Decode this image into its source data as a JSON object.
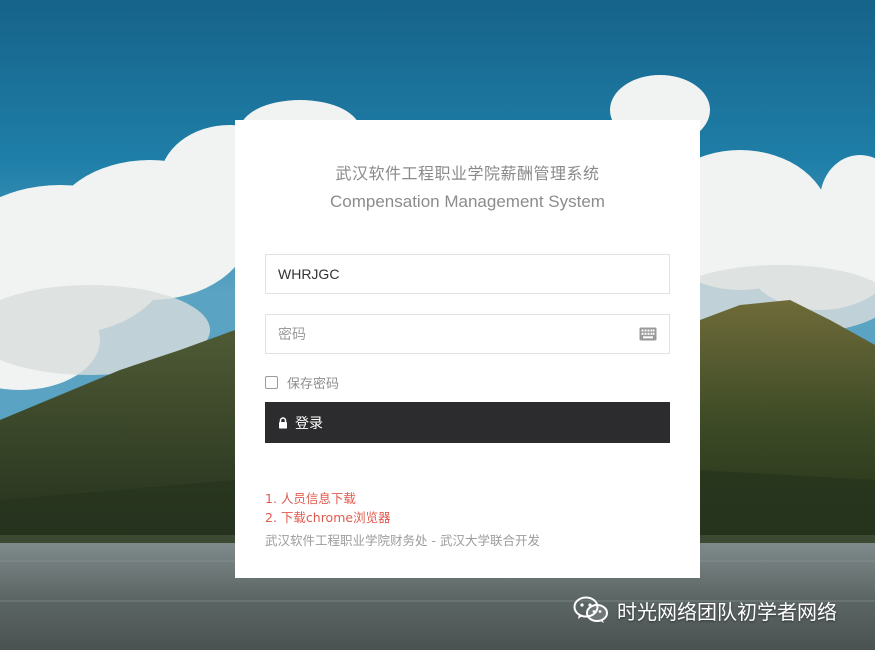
{
  "login": {
    "title_cn": "武汉软件工程职业学院薪酬管理系统",
    "title_en": "Compensation Management System",
    "username_value": "WHRJGC",
    "password_placeholder": "密码",
    "remember_label": "保存密码",
    "remember_checked": false,
    "login_button": "登录",
    "link_1": "1. 人员信息下载",
    "link_2": "2. 下载chrome浏览器",
    "footer_note": "武汉软件工程职业学院财务处 - 武汉大学联合开发"
  },
  "watermark": {
    "text": "时光网络团队初学者网络",
    "icon": "wechat-icon"
  },
  "icons": {
    "password_field": "keyboard-icon",
    "login_button": "lock-icon"
  },
  "colors": {
    "button_bg": "#2c2c2e",
    "link_red": "#e05b4f",
    "card_bg": "#ffffff"
  }
}
